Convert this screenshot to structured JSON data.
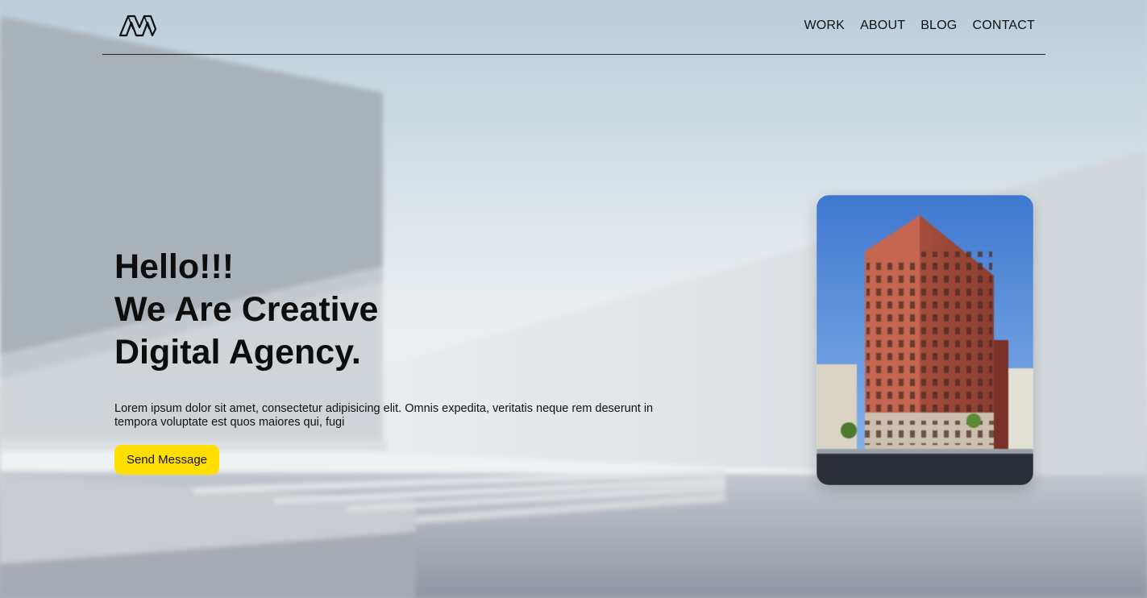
{
  "header": {
    "logo_icon": "agency-logo-icon",
    "nav": [
      "WORK",
      "ABOUT",
      "BLOG",
      "CONTACT"
    ]
  },
  "hero": {
    "title_lines": [
      "Hello!!!",
      "We Are Creative",
      "Digital Agency."
    ],
    "description": "Lorem ipsum dolor sit amet, consectetur adipisicing elit. Omnis expedita, veritatis neque rem deserunt in tempora voluptate est quos maiores qui, fugi",
    "button_label": "Send Message"
  },
  "colors": {
    "accent": "#ffde00",
    "text": "#111111"
  },
  "card": {
    "image": "building-photo"
  }
}
